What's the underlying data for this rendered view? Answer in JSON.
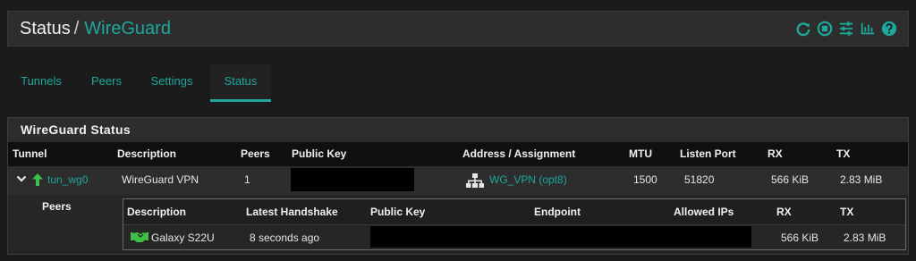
{
  "breadcrumb": {
    "root": "Status",
    "separator": "/",
    "current": "WireGuard"
  },
  "header_icons": [
    "reload-icon",
    "stop-icon",
    "settings-sliders-icon",
    "chart-icon",
    "help-icon"
  ],
  "colors": {
    "accent": "#1ea79c",
    "green_arrow": "#3fbf4a",
    "background": "#1b1b1b"
  },
  "tabs": [
    {
      "label": "Tunnels",
      "active": false
    },
    {
      "label": "Peers",
      "active": false
    },
    {
      "label": "Settings",
      "active": false
    },
    {
      "label": "Status",
      "active": true
    }
  ],
  "panel": {
    "title": "WireGuard Status",
    "columns": [
      "Tunnel",
      "Description",
      "Peers",
      "Public Key",
      "Address / Assignment",
      "MTU",
      "Listen Port",
      "RX",
      "TX"
    ],
    "tunnel_row": {
      "tunnel": "tun_wg0",
      "description": "WireGuard VPN",
      "peers": "1",
      "public_key": "",
      "assignment": "WG_VPN (opt8)",
      "mtu": "1500",
      "listen_port": "51820",
      "rx": "566 KiB",
      "tx": "2.83 MiB"
    },
    "peers_label": "Peers",
    "peer_columns": [
      "Description",
      "Latest Handshake",
      "Public Key",
      "Endpoint",
      "Allowed IPs",
      "RX",
      "TX"
    ],
    "peer_row": {
      "description": "Galaxy S22U",
      "latest_handshake": "8 seconds ago",
      "public_key": "",
      "endpoint": "",
      "allowed_ips": "",
      "rx": "566 KiB",
      "tx": "2.83 MiB"
    }
  }
}
